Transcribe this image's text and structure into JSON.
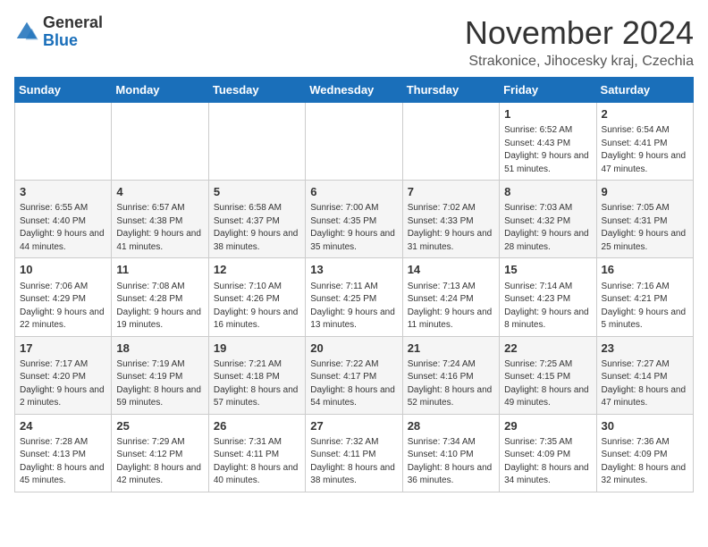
{
  "header": {
    "logo_general": "General",
    "logo_blue": "Blue",
    "title": "November 2024",
    "location": "Strakonice, Jihocesky kraj, Czechia"
  },
  "days_of_week": [
    "Sunday",
    "Monday",
    "Tuesday",
    "Wednesday",
    "Thursday",
    "Friday",
    "Saturday"
  ],
  "weeks": [
    [
      {
        "day": "",
        "info": ""
      },
      {
        "day": "",
        "info": ""
      },
      {
        "day": "",
        "info": ""
      },
      {
        "day": "",
        "info": ""
      },
      {
        "day": "",
        "info": ""
      },
      {
        "day": "1",
        "info": "Sunrise: 6:52 AM\nSunset: 4:43 PM\nDaylight: 9 hours and 51 minutes."
      },
      {
        "day": "2",
        "info": "Sunrise: 6:54 AM\nSunset: 4:41 PM\nDaylight: 9 hours and 47 minutes."
      }
    ],
    [
      {
        "day": "3",
        "info": "Sunrise: 6:55 AM\nSunset: 4:40 PM\nDaylight: 9 hours and 44 minutes."
      },
      {
        "day": "4",
        "info": "Sunrise: 6:57 AM\nSunset: 4:38 PM\nDaylight: 9 hours and 41 minutes."
      },
      {
        "day": "5",
        "info": "Sunrise: 6:58 AM\nSunset: 4:37 PM\nDaylight: 9 hours and 38 minutes."
      },
      {
        "day": "6",
        "info": "Sunrise: 7:00 AM\nSunset: 4:35 PM\nDaylight: 9 hours and 35 minutes."
      },
      {
        "day": "7",
        "info": "Sunrise: 7:02 AM\nSunset: 4:33 PM\nDaylight: 9 hours and 31 minutes."
      },
      {
        "day": "8",
        "info": "Sunrise: 7:03 AM\nSunset: 4:32 PM\nDaylight: 9 hours and 28 minutes."
      },
      {
        "day": "9",
        "info": "Sunrise: 7:05 AM\nSunset: 4:31 PM\nDaylight: 9 hours and 25 minutes."
      }
    ],
    [
      {
        "day": "10",
        "info": "Sunrise: 7:06 AM\nSunset: 4:29 PM\nDaylight: 9 hours and 22 minutes."
      },
      {
        "day": "11",
        "info": "Sunrise: 7:08 AM\nSunset: 4:28 PM\nDaylight: 9 hours and 19 minutes."
      },
      {
        "day": "12",
        "info": "Sunrise: 7:10 AM\nSunset: 4:26 PM\nDaylight: 9 hours and 16 minutes."
      },
      {
        "day": "13",
        "info": "Sunrise: 7:11 AM\nSunset: 4:25 PM\nDaylight: 9 hours and 13 minutes."
      },
      {
        "day": "14",
        "info": "Sunrise: 7:13 AM\nSunset: 4:24 PM\nDaylight: 9 hours and 11 minutes."
      },
      {
        "day": "15",
        "info": "Sunrise: 7:14 AM\nSunset: 4:23 PM\nDaylight: 9 hours and 8 minutes."
      },
      {
        "day": "16",
        "info": "Sunrise: 7:16 AM\nSunset: 4:21 PM\nDaylight: 9 hours and 5 minutes."
      }
    ],
    [
      {
        "day": "17",
        "info": "Sunrise: 7:17 AM\nSunset: 4:20 PM\nDaylight: 9 hours and 2 minutes."
      },
      {
        "day": "18",
        "info": "Sunrise: 7:19 AM\nSunset: 4:19 PM\nDaylight: 8 hours and 59 minutes."
      },
      {
        "day": "19",
        "info": "Sunrise: 7:21 AM\nSunset: 4:18 PM\nDaylight: 8 hours and 57 minutes."
      },
      {
        "day": "20",
        "info": "Sunrise: 7:22 AM\nSunset: 4:17 PM\nDaylight: 8 hours and 54 minutes."
      },
      {
        "day": "21",
        "info": "Sunrise: 7:24 AM\nSunset: 4:16 PM\nDaylight: 8 hours and 52 minutes."
      },
      {
        "day": "22",
        "info": "Sunrise: 7:25 AM\nSunset: 4:15 PM\nDaylight: 8 hours and 49 minutes."
      },
      {
        "day": "23",
        "info": "Sunrise: 7:27 AM\nSunset: 4:14 PM\nDaylight: 8 hours and 47 minutes."
      }
    ],
    [
      {
        "day": "24",
        "info": "Sunrise: 7:28 AM\nSunset: 4:13 PM\nDaylight: 8 hours and 45 minutes."
      },
      {
        "day": "25",
        "info": "Sunrise: 7:29 AM\nSunset: 4:12 PM\nDaylight: 8 hours and 42 minutes."
      },
      {
        "day": "26",
        "info": "Sunrise: 7:31 AM\nSunset: 4:11 PM\nDaylight: 8 hours and 40 minutes."
      },
      {
        "day": "27",
        "info": "Sunrise: 7:32 AM\nSunset: 4:11 PM\nDaylight: 8 hours and 38 minutes."
      },
      {
        "day": "28",
        "info": "Sunrise: 7:34 AM\nSunset: 4:10 PM\nDaylight: 8 hours and 36 minutes."
      },
      {
        "day": "29",
        "info": "Sunrise: 7:35 AM\nSunset: 4:09 PM\nDaylight: 8 hours and 34 minutes."
      },
      {
        "day": "30",
        "info": "Sunrise: 7:36 AM\nSunset: 4:09 PM\nDaylight: 8 hours and 32 minutes."
      }
    ]
  ]
}
